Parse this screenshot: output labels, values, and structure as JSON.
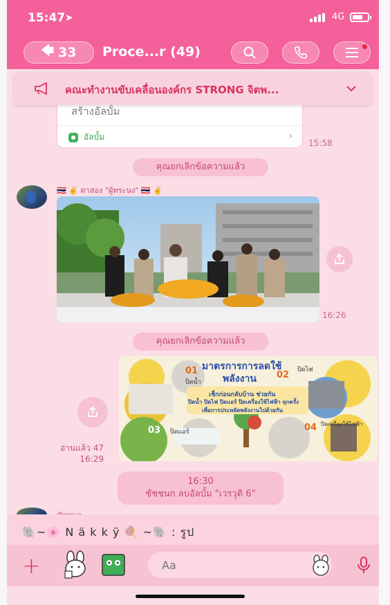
{
  "status": {
    "time": "15:47",
    "network": "4G",
    "location_icon": "location-arrow-icon"
  },
  "header": {
    "back_count": "33",
    "title": "Proce...r (49)"
  },
  "announcement": {
    "text": "คณะทำงานขับเคลื่อนองค์กร STRONG จิตพ..."
  },
  "album_card": {
    "title": "สร้างอัลบั้ม",
    "link_label": "อัลบั้ม",
    "time": "15:58"
  },
  "messages": {
    "unsent_1": "คุณยกเลิกข้อความแล้ว",
    "sender_1": "🇹🇭 ✌️ ตาสอง \"ผู้ทระนง\" 🇹🇭 ✌️",
    "photo_time": "16:26",
    "unsent_2": "คุณยกเลิกข้อความแล้ว",
    "read_count": "อ่านแล้ว 47",
    "poster_time": "16:29",
    "system_time": "16:30",
    "system_text": "ชัชชนก ลบอัลบั้ม \"เวรวุติ 6\"",
    "sender_2": "ชัชชนก"
  },
  "poster": {
    "title_line1": "มาตรการการลดใช้",
    "title_line2": "พลังงาน",
    "slogan_1": "เช็กก่อนกลับบ้าน ช่วยกัน",
    "slogan_2": "ปิดน้ำ ปิดไฟ ปิดแอร์ ปิดเครื่องใช้ไฟฟ้า ทุกครั้ง",
    "slogan_3": "เพื่อการประหยัดพลังงานไปด้วยกัน",
    "step_01": "01",
    "step_01_label": "ปิดน้ำ",
    "step_02": "02",
    "step_02_label": "ปิดไฟ",
    "step_03": "03",
    "step_03_label": "ปิดแอร์",
    "step_04": "04",
    "step_04_label": "ปิดเครื่องใช้ไฟฟ้า"
  },
  "reply_preview": {
    "text": "🐘~🌸 N ä k k ÿ 🍭 ~🐘 : รูป"
  },
  "input": {
    "placeholder": "Aa"
  },
  "colors": {
    "header": "#f4619a",
    "background": "#fbdde6",
    "accent": "#d8335e"
  }
}
